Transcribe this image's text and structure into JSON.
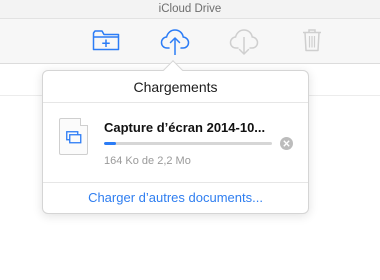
{
  "window": {
    "title": "iCloud Drive"
  },
  "toolbar": {
    "new_folder_icon": "new-folder-icon",
    "upload_icon": "upload-cloud-icon",
    "download_icon": "download-cloud-icon",
    "delete_icon": "trash-icon",
    "accent_color": "#2b7cf6",
    "disabled_color": "#cfcfcf"
  },
  "popover": {
    "title": "Chargements",
    "items": [
      {
        "file_name": "Capture d’écran 2014-10...",
        "progress_text": "164 Ko de 2,2 Mo",
        "progress_fraction": 0.07,
        "icon": "file-document-icon",
        "cancel_icon": "cancel-circle-icon"
      }
    ],
    "footer_link": "Charger d’autres documents..."
  }
}
